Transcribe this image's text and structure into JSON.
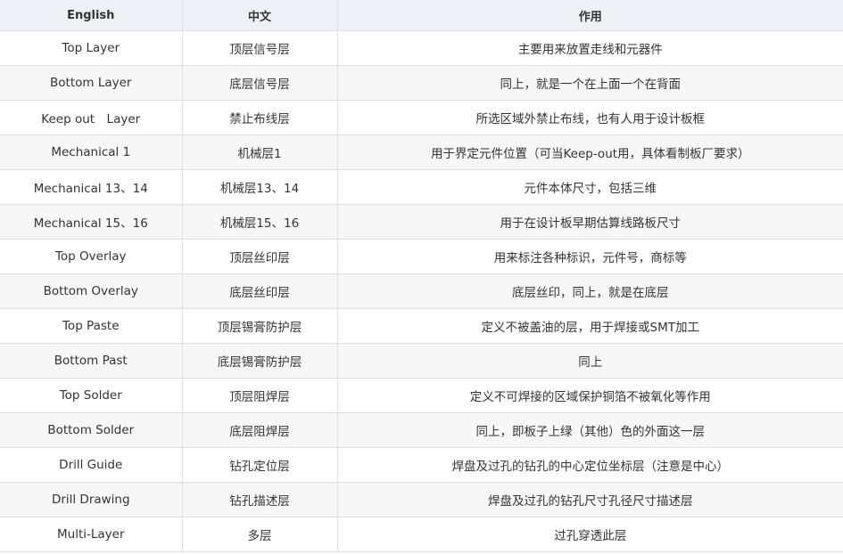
{
  "table": {
    "headers": [
      "English",
      "中文",
      "作用"
    ],
    "rows": [
      [
        "Top Layer",
        "顶层信号层",
        "主要用来放置走线和元器件"
      ],
      [
        "Bottom Layer",
        "底层信号层",
        "同上，就是一个在上面一个在背面"
      ],
      [
        "Keep out　Layer",
        "禁止布线层",
        "所选区域外禁止布线，也有人用于设计板框"
      ],
      [
        "Mechanical 1",
        "机械层1",
        "用于界定元件位置（可当Keep-out用，具体看制板厂要求）"
      ],
      [
        "Mechanical 13、14",
        "机械层13、14",
        "元件本体尺寸，包括三维"
      ],
      [
        "Mechanical 15、16",
        "机械层15、16",
        "用于在设计板早期估算线路板尺寸"
      ],
      [
        "Top Overlay",
        "顶层丝印层",
        "用来标注各种标识，元件号，商标等"
      ],
      [
        "Bottom Overlay",
        "底层丝印层",
        "底层丝印，同上，就是在底层"
      ],
      [
        "Top Paste",
        "顶层锡膏防护层",
        "定义不被盖油的层，用于焊接或SMT加工"
      ],
      [
        "Bottom Past",
        "底层锡膏防护层",
        "同上"
      ],
      [
        "Top Solder",
        "顶层阻焊层",
        "定义不可焊接的区域保护铜箔不被氧化等作用"
      ],
      [
        "Bottom Solder",
        "底层阻焊层",
        "同上，即板子上绿（其他）色的外面这一层"
      ],
      [
        "Drill Guide",
        "钻孔定位层",
        "焊盘及过孔的钻孔的中心定位坐标层（注意是中心）"
      ],
      [
        "Drill Drawing",
        "钻孔描述层",
        "焊盘及过孔的钻孔尺寸孔径尺寸描述层"
      ],
      [
        "Multi-Layer",
        "多层",
        "过孔穿透此层"
      ]
    ]
  },
  "colors": {
    "header_bg": "#eef0f5",
    "stripe_bg": "#f7f7f7",
    "border": "#dcdfe6",
    "text": "#333333"
  }
}
